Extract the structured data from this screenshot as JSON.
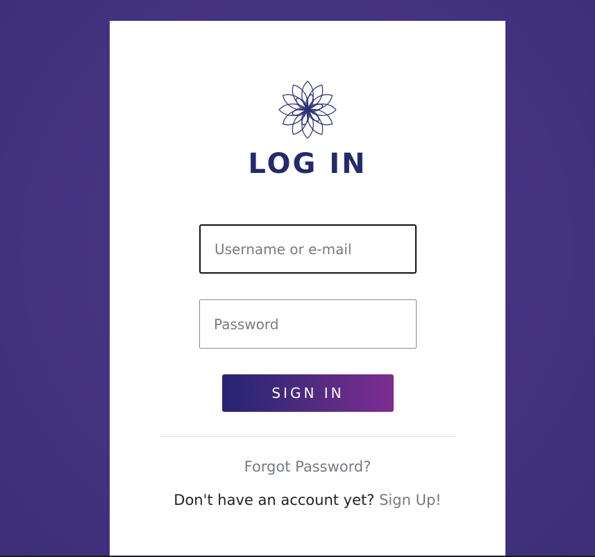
{
  "login": {
    "title": "LOG IN",
    "logo_icon": "lotus-flower-icon",
    "username": {
      "value": "",
      "placeholder": "Username or e-mail"
    },
    "password": {
      "value": "",
      "placeholder": "Password"
    },
    "signin_label": "SIGN IN",
    "forgot_label": "Forgot Password?",
    "no_account_text": "Don't have an account yet?",
    "signup_label": "Sign Up!"
  },
  "colors": {
    "background": "#463481",
    "title": "#252a6a",
    "button_gradient_start": "#252472",
    "button_gradient_end": "#7d2d92",
    "link": "#747b82"
  }
}
